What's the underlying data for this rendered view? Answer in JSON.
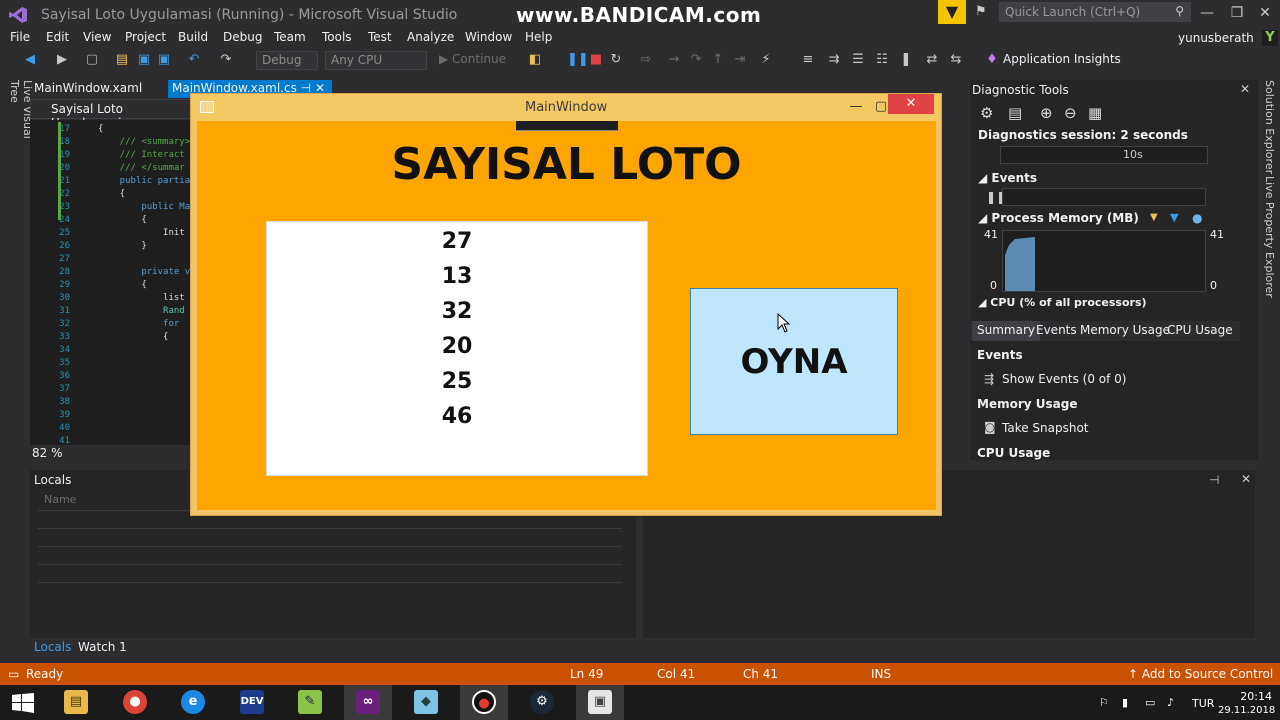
{
  "titlebar": {
    "app_title": "Sayisal Loto Uygulamasi (Running) - Microsoft Visual Studio",
    "watermark": "www.BANDICAM.com",
    "quick_launch_placeholder": "Quick Launch (Ctrl+Q)",
    "user_name": "yunusberath",
    "user_initial": "Y"
  },
  "menu": {
    "items": [
      "File",
      "Edit",
      "View",
      "Project",
      "Build",
      "Debug",
      "Team",
      "Tools",
      "Test",
      "Analyze",
      "Window",
      "Help"
    ]
  },
  "toolbar": {
    "config_combo": "Debug",
    "platform_combo": "Any CPU",
    "continue_label": "Continue",
    "app_insights_label": "Application Insights"
  },
  "left_sidebar": {
    "live_visual_tree": "Live Visual Tree"
  },
  "doc_tabs": [
    {
      "label": "MainWindow.xaml"
    },
    {
      "label": "MainWindow.xaml.cs"
    }
  ],
  "nav_bar": {
    "project": "Sayisal Loto Uygulamasi"
  },
  "editor": {
    "lines": [
      {
        "num": "17",
        "text": "{",
        "cls": "code"
      },
      {
        "num": "18",
        "text": "    /// <summary>",
        "cls": "comment"
      },
      {
        "num": "19",
        "text": "    /// Interact",
        "cls": "comment"
      },
      {
        "num": "20",
        "text": "    /// </summar",
        "cls": "comment"
      },
      {
        "num": "21",
        "text": "    public partia",
        "cls": "kw"
      },
      {
        "num": "22",
        "text": "    {",
        "cls": "code"
      },
      {
        "num": "23",
        "text": "        public Ma",
        "cls": "kw"
      },
      {
        "num": "24",
        "text": "        {",
        "cls": "code"
      },
      {
        "num": "25",
        "text": "            Init",
        "cls": "code"
      },
      {
        "num": "26",
        "text": "        }",
        "cls": "code"
      },
      {
        "num": "27",
        "text": "",
        "cls": "code"
      },
      {
        "num": "28",
        "text": "        private v",
        "cls": "kw"
      },
      {
        "num": "29",
        "text": "        {",
        "cls": "code"
      },
      {
        "num": "30",
        "text": "            list",
        "cls": "code"
      },
      {
        "num": "31",
        "text": "            Rand",
        "cls": "cls"
      },
      {
        "num": "32",
        "text": "            for",
        "cls": "kw"
      },
      {
        "num": "33",
        "text": "            {",
        "cls": "code"
      },
      {
        "num": "34",
        "text": "",
        "cls": "code"
      },
      {
        "num": "35",
        "text": "",
        "cls": "code"
      },
      {
        "num": "36",
        "text": "",
        "cls": "code"
      },
      {
        "num": "37",
        "text": "",
        "cls": "code"
      },
      {
        "num": "38",
        "text": "",
        "cls": "code"
      },
      {
        "num": "39",
        "text": "",
        "cls": "code"
      },
      {
        "num": "40",
        "text": "",
        "cls": "code"
      },
      {
        "num": "41",
        "text": "",
        "cls": "code"
      }
    ],
    "zoom": "82 %"
  },
  "locals": {
    "title": "Locals",
    "column_name": "Name",
    "tabs": [
      "Locals",
      "Watch 1"
    ]
  },
  "diagnostics": {
    "title": "Diagnostic Tools",
    "session": "Diagnostics session: 2 seconds",
    "timeline_label": "10s",
    "events_label": "Events",
    "process_memory_label": "Process Memory (MB)",
    "memory_max": "41",
    "memory_min": "0",
    "memory_max_right": "41",
    "memory_min_right": "0",
    "cpu_label": "CPU (% of all processors)",
    "tabs": [
      "Summary",
      "Events",
      "Memory Usage",
      "CPU Usage"
    ],
    "events_section": "Events",
    "show_events": "Show Events (0 of 0)",
    "memory_section": "Memory Usage",
    "take_snapshot": "Take Snapshot",
    "cpu_section": "CPU Usage",
    "solution_explorer": "Solution Explorer",
    "live_property_explorer": "Live Property Explorer"
  },
  "wpf_window": {
    "title": "MainWindow",
    "heading": "SAYISAL LOTO",
    "numbers": [
      "27",
      "13",
      "32",
      "20",
      "25",
      "46"
    ],
    "play_button": "OYNA"
  },
  "statusbar": {
    "ready": "Ready",
    "ln": "Ln 49",
    "col": "Col 41",
    "ch": "Ch 41",
    "ins": "INS",
    "source_control": "Add to Source Control"
  },
  "taskbar": {
    "lang": "TUR",
    "time": "20:14",
    "date": "29.11.2018"
  }
}
